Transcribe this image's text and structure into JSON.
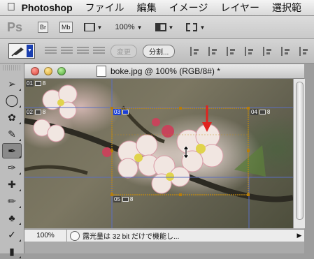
{
  "menubar": {
    "app_name": "Photoshop",
    "items": [
      "ファイル",
      "編集",
      "イメージ",
      "レイヤー",
      "選択範"
    ]
  },
  "appbar": {
    "logo": "Ps",
    "bridge": "Br",
    "minibridge": "Mb",
    "zoom": "100%"
  },
  "optionsbar": {
    "promote_label": "変更",
    "divide_label": "分割..."
  },
  "document": {
    "title": "boke.jpg @ 100% (RGB/8#) *",
    "zoom": "100%",
    "status_info": "露光量は 32 bit だけで機能し..."
  },
  "slices": [
    {
      "label": "01",
      "selected": false
    },
    {
      "label": "02",
      "selected": false
    },
    {
      "label": "03",
      "selected": true
    },
    {
      "label": "04",
      "selected": false
    },
    {
      "label": "05",
      "selected": false
    }
  ],
  "slice_sublabel": "8",
  "colors": {
    "slice_selected": "#1a3fd6",
    "slice_border": "#c28a10",
    "slice_line": "#5b6fc2",
    "arrow": "#e0231f"
  },
  "icons": {
    "apple": "apple-icon",
    "screen_mode": "screen-mode-icon",
    "arrange": "arrange-documents-icon",
    "view_extras": "view-extras-icon"
  }
}
